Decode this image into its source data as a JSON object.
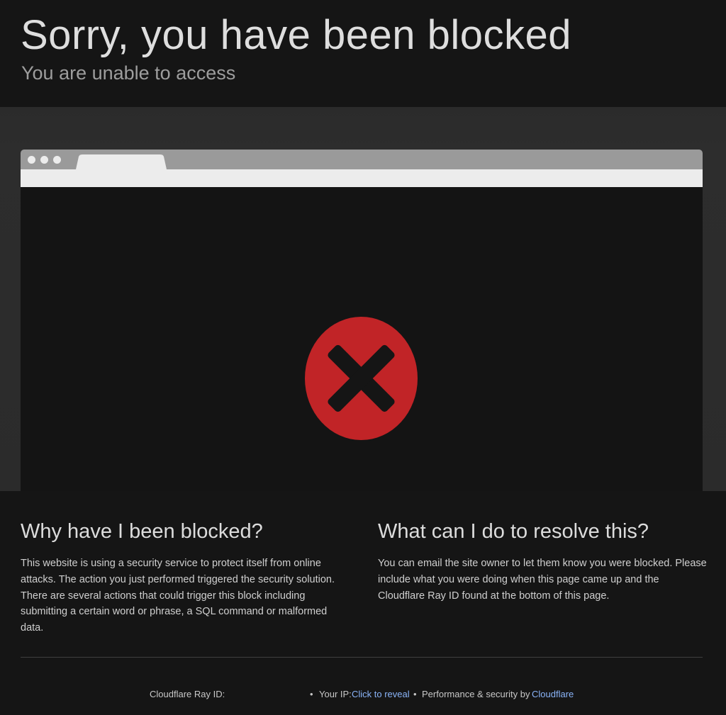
{
  "header": {
    "title": "Sorry, you have been blocked",
    "subtitle": "You are unable to access"
  },
  "illustration": {
    "error_color": "#c12427",
    "icon": "x-close-icon"
  },
  "why_section": {
    "heading": "Why have I been blocked?",
    "body": "This website is using a security service to protect itself from online attacks. The action you just performed triggered the security solution. There are several actions that could trigger this block including submitting a certain word or phrase, a SQL command or malformed data."
  },
  "resolve_section": {
    "heading": "What can I do to resolve this?",
    "body": "You can email the site owner to let them know you were blocked. Please include what you were doing when this page came up and the Cloudflare Ray ID found at the bottom of this page."
  },
  "footer": {
    "ray_id_label": "Cloudflare Ray ID:",
    "bullet": "•",
    "ip_label": "Your IP:",
    "ip_link": "Click to reveal",
    "perf_label": "Performance & security by",
    "perf_link": "Cloudflare",
    "link_color": "#8ab4f8"
  }
}
